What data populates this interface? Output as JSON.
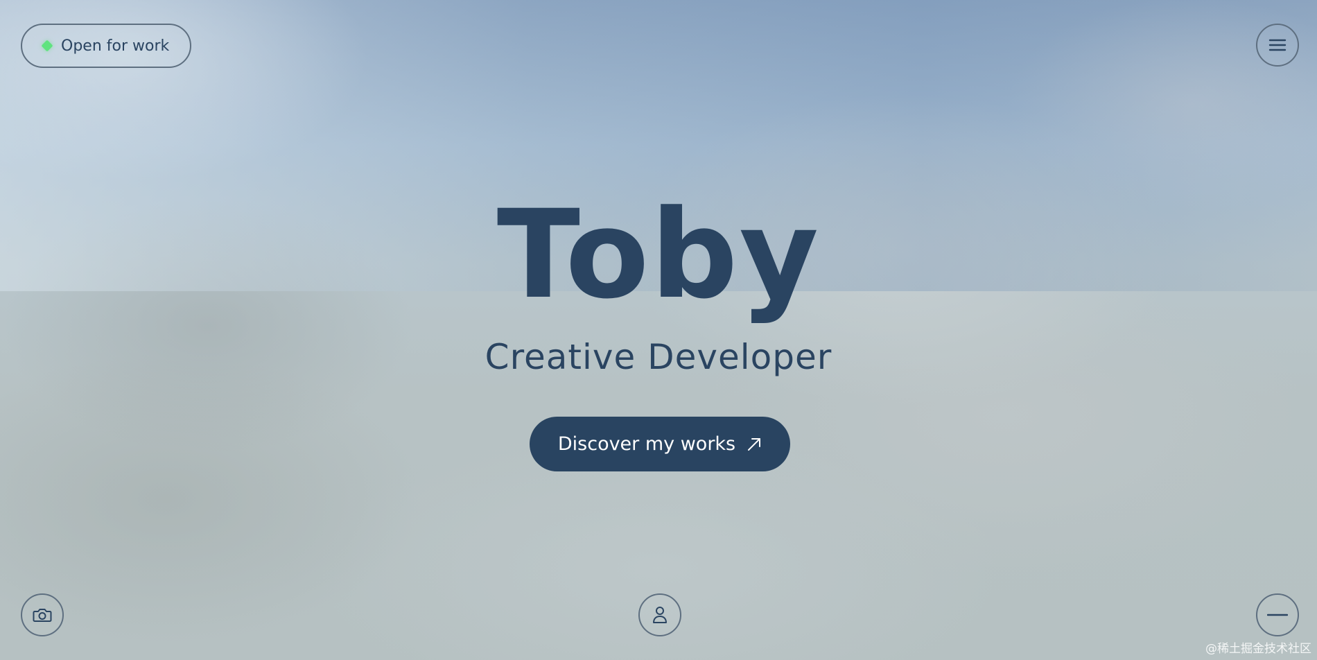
{
  "status_pill": {
    "label": "Open for work",
    "dot_color": "#5fe37f"
  },
  "hero": {
    "title": "Toby",
    "subtitle": "Creative Developer"
  },
  "cta": {
    "label": "Discover my works",
    "icon": "arrow-up-right-icon"
  },
  "controls": {
    "top_right": "menu-icon",
    "bottom_left": "camera-icon",
    "bottom_center": "user-icon",
    "bottom_right": "minus-icon"
  },
  "watermark": "@稀土掘金技术社区",
  "colors": {
    "text": "#2a4461",
    "button_bg": "#294461",
    "button_text": "#ffffff",
    "border": "#5e6f80"
  }
}
